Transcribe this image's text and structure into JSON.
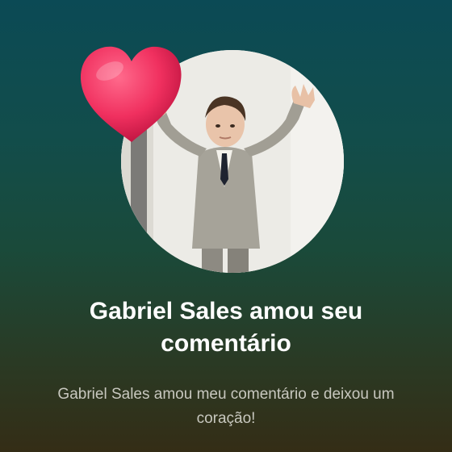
{
  "notification": {
    "title": "Gabriel Sales amou seu comentário",
    "message": "Gabriel Sales amou meu comentário e deixou um coração!",
    "reaction_icon": "heart-icon",
    "colors": {
      "background_top": "#0b4a55",
      "background_bottom": "#342d16",
      "title": "#ffffff",
      "message": "#c8c8bf",
      "heart": "#f0305f"
    }
  }
}
